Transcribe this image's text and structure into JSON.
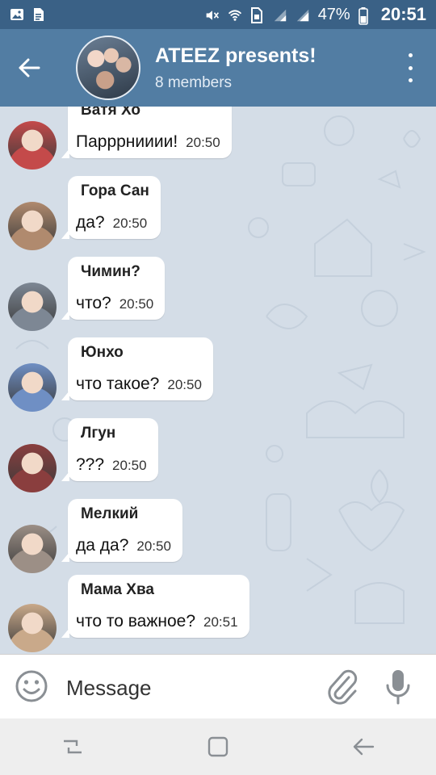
{
  "status_bar": {
    "battery_percent": "47%",
    "time": "20:51"
  },
  "header": {
    "title": "ATEEZ presents!",
    "subtitle": "8 members"
  },
  "messages": [
    {
      "sender": "Ватя Хо",
      "text": "Парррнииии!",
      "time": "20:50",
      "avatar_color": "#c44a4a"
    },
    {
      "sender": "Гора Сан",
      "text": "да?",
      "time": "20:50",
      "avatar_color": "#b08a6e"
    },
    {
      "sender": "Чимин?",
      "text": "что?",
      "time": "20:50",
      "avatar_color": "#7d8794"
    },
    {
      "sender": "Юнхо",
      "text": "что такое?",
      "time": "20:50",
      "avatar_color": "#6f8fc4"
    },
    {
      "sender": "Лгун",
      "text": "???",
      "time": "20:50",
      "avatar_color": "#8a3e3e"
    },
    {
      "sender": "Мелкий",
      "text": "да да?",
      "time": "20:50",
      "avatar_color": "#9c8f86"
    },
    {
      "sender": "Мама Хва",
      "text": "что то важное?",
      "time": "20:51",
      "avatar_color": "#c9a98a"
    }
  ],
  "input": {
    "placeholder": "Message"
  },
  "colors": {
    "header_bg": "#527da3",
    "status_bg": "#3a6186",
    "chat_bg": "#d4dde7"
  }
}
